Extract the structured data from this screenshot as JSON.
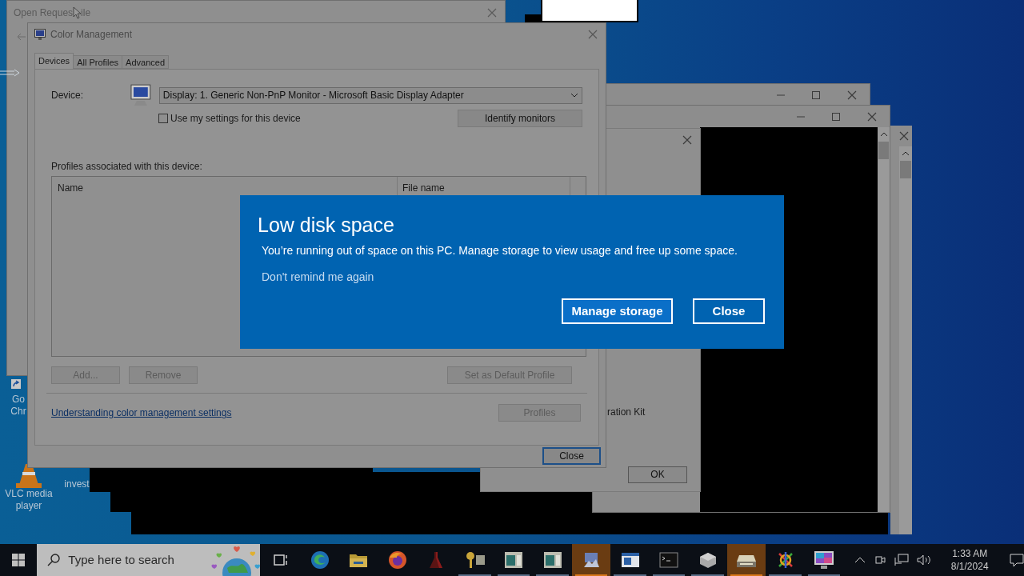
{
  "desktop_icons": [
    {
      "label": "Go Chr"
    },
    {
      "label": "VLC media player"
    },
    {
      "label": "invest"
    }
  ],
  "open_request_window": {
    "title_parts": [
      "Open Reques",
      "ile"
    ]
  },
  "back_windows": [
    {
      "kind": "titled"
    },
    {
      "kind": "titled-console"
    },
    {
      "kind": "scroll-edge"
    }
  ],
  "setup_dialog": {
    "text": "ration Kit",
    "button": "OK"
  },
  "color_management": {
    "title": "Color Management",
    "tabs": [
      {
        "label": "Devices",
        "selected": true
      },
      {
        "label": "All Profiles",
        "selected": false
      },
      {
        "label": "Advanced",
        "selected": false
      }
    ],
    "device_label": "Device:",
    "device_value": "Display: 1. Generic Non-PnP Monitor - Microsoft Basic Display Adapter",
    "use_settings": {
      "label": "Use my settings for this device",
      "checked": false
    },
    "identify_button": {
      "label": "Identify monitors",
      "disabled": false
    },
    "profiles_label": "Profiles associated with this device:",
    "columns": [
      "Name",
      "File name"
    ],
    "list_buttons": [
      {
        "label": "Add...",
        "disabled": true
      },
      {
        "label": "Remove",
        "disabled": true
      },
      {
        "label": "Set as Default Profile",
        "disabled": true
      }
    ],
    "link": "Understanding color management settings",
    "profiles_button": {
      "label": "Profiles",
      "disabled": true
    },
    "close_button": {
      "label": "Close",
      "focused": true
    }
  },
  "toast": {
    "title": "Low disk space",
    "message": "You’re running out of space on this PC. Manage storage to view usage and free up some space.",
    "link": "Don't remind me again",
    "buttons": [
      "Manage storage",
      "Close"
    ]
  },
  "taskbar": {
    "search_placeholder": "Type here to search",
    "apps": [
      {
        "kind": "task-view",
        "running": false,
        "active": false
      },
      {
        "kind": "edge",
        "running": false,
        "active": false
      },
      {
        "kind": "folder",
        "running": false,
        "active": false
      },
      {
        "kind": "firefox",
        "running": false,
        "active": false
      },
      {
        "kind": "flask",
        "running": false,
        "active": false
      },
      {
        "kind": "keys",
        "running": true,
        "active": false
      },
      {
        "kind": "window",
        "running": true,
        "active": false
      },
      {
        "kind": "window",
        "running": true,
        "active": false
      },
      {
        "kind": "network",
        "running": true,
        "active": true
      },
      {
        "kind": "document",
        "running": true,
        "active": false
      },
      {
        "kind": "terminal",
        "running": true,
        "active": false
      },
      {
        "kind": "cube",
        "running": true,
        "active": false
      },
      {
        "kind": "scanner",
        "running": true,
        "active": true
      },
      {
        "kind": "tangle",
        "running": true,
        "active": false
      },
      {
        "kind": "monitor",
        "running": true,
        "active": false
      }
    ],
    "time": "1:33 AM",
    "date": "8/1/2024"
  }
}
